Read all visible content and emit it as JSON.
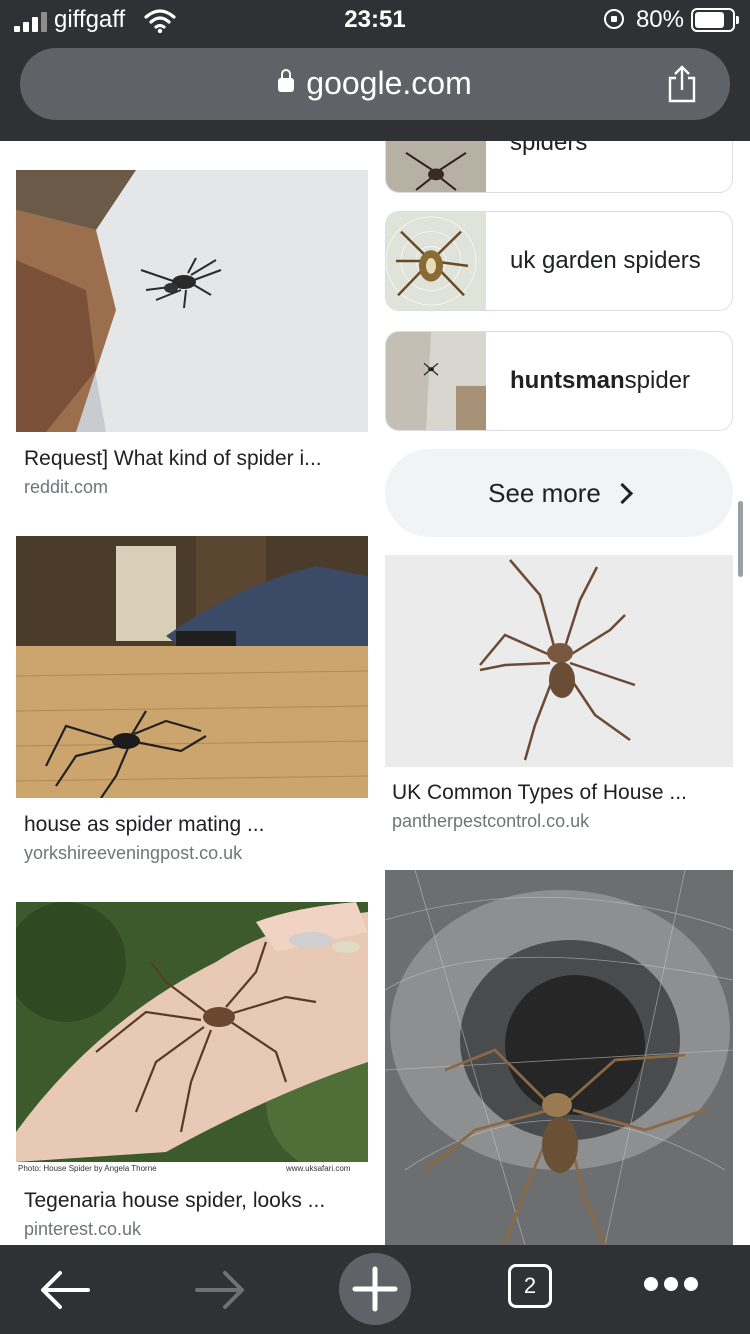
{
  "status": {
    "carrier": "giffgaff",
    "time": "23:51",
    "battery": "80%",
    "battery_level": 0.8
  },
  "browser": {
    "url": "google.com"
  },
  "related_searches": [
    {
      "prefix": "",
      "bold": "",
      "text": "spiders"
    },
    {
      "prefix": "",
      "bold": "",
      "text": "uk garden spiders"
    },
    {
      "prefix": "",
      "bold": "huntsman",
      "text": " spider"
    }
  ],
  "see_more": "See more",
  "results": [
    {
      "title": "Request] What kind of spider i...",
      "source": "reddit.com"
    },
    {
      "title": "house as spider mating ...",
      "source": "yorkshireeveningpost.co.uk"
    },
    {
      "title": "Tegenaria house spider, looks ...",
      "source": "pinterest.co.uk"
    },
    {
      "title": "UK Common Types of House ...",
      "source": "pantherpestcontrol.co.uk"
    }
  ],
  "image_captions": {
    "left": "Photo: House Spider by Angela Thorne",
    "right": "www.uksafari.com"
  },
  "toolbar": {
    "tab_count": "2"
  }
}
